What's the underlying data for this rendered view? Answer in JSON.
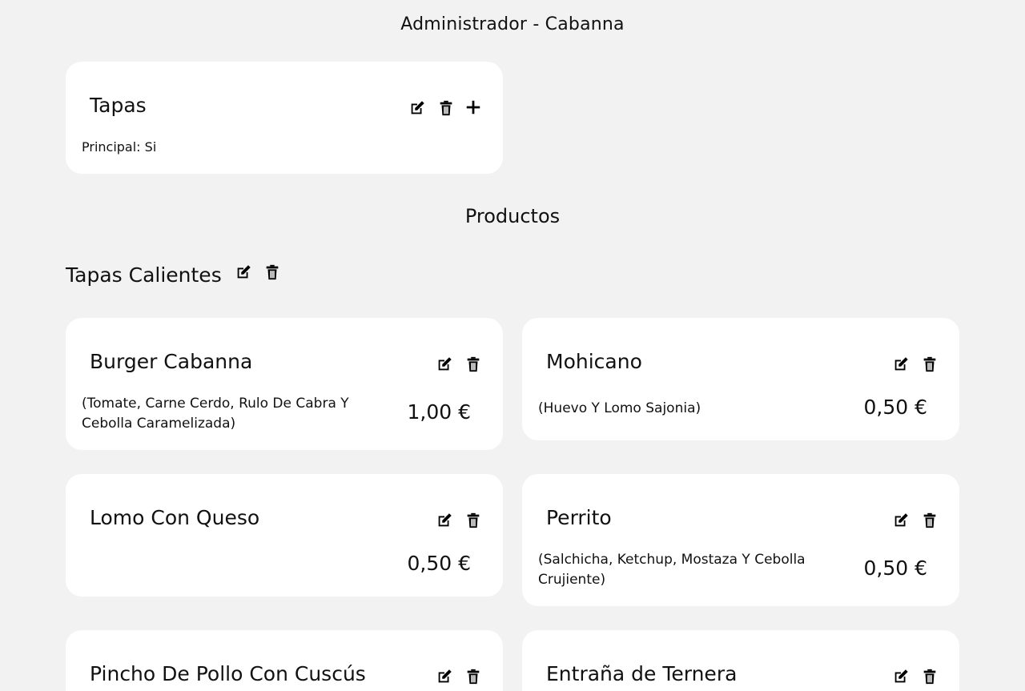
{
  "header": {
    "title": "Administrador - Cabanna"
  },
  "category": {
    "name": "Tapas",
    "principal": "Principal: Si"
  },
  "products_section": {
    "title": "Productos"
  },
  "subcategory": {
    "name": "Tapas Calientes"
  },
  "icons": {
    "edit": "edit-icon",
    "delete": "trash-icon",
    "add": "plus-icon"
  },
  "products": [
    {
      "name": "Burger Cabanna",
      "description": "(Tomate, Carne Cerdo, Rulo De Cabra Y Cebolla Caramelizada)",
      "price": "1,00 €"
    },
    {
      "name": "Mohicano",
      "description": "(Huevo Y Lomo Sajonia)",
      "price": "0,50 €"
    },
    {
      "name": "Lomo Con Queso",
      "description": "",
      "price": "0,50 €"
    },
    {
      "name": "Perrito",
      "description": "(Salchicha, Ketchup, Mostaza Y Cebolla Crujiente)",
      "price": "0,50 €"
    },
    {
      "name": "Pincho De Pollo Con Cuscús",
      "description": "",
      "price": ""
    },
    {
      "name": "Entraña de Ternera",
      "description": "",
      "price": ""
    }
  ]
}
